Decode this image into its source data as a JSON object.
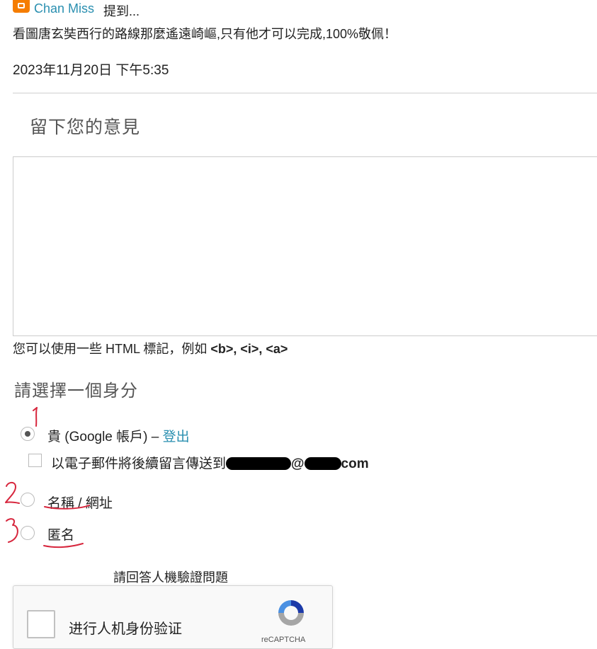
{
  "previous_comment": {
    "author": "Chan Miss",
    "said": "提到...",
    "text": "看圖唐玄奘西行的路線那麼遙遠崎嶇,只有他才可以完成,100%敬佩！",
    "date": "2023年11月20日 下午5:35"
  },
  "comment_form": {
    "heading": "留下您的意見",
    "textarea_value": "",
    "html_hint_prefix": "您可以使用一些 HTML 標記，例如",
    "html_hint_tags": "<b>, <i>, <a>"
  },
  "identity": {
    "heading": "請選擇一個身分",
    "google_option": "貴 (Google 帳戶) –",
    "signout_label": "登出",
    "email_followup_label": "以電子郵件將後續留言傳送到",
    "email_visible_part_at": "@",
    "email_visible_part_tld": "com",
    "name_url_option": "名稱 / 網址",
    "anonymous_option": "匿名",
    "selected": "google"
  },
  "annotations": {
    "mark_1": "1",
    "mark_2": "2",
    "mark_3": "3",
    "color": "#d7263d"
  },
  "captcha": {
    "question": "請回答人機驗證問題",
    "checkbox_label": "进行人机身份验证",
    "brand": "reCAPTCHA"
  },
  "colors": {
    "link": "#2a8fb0",
    "blogger_orange": "#f57d00"
  }
}
